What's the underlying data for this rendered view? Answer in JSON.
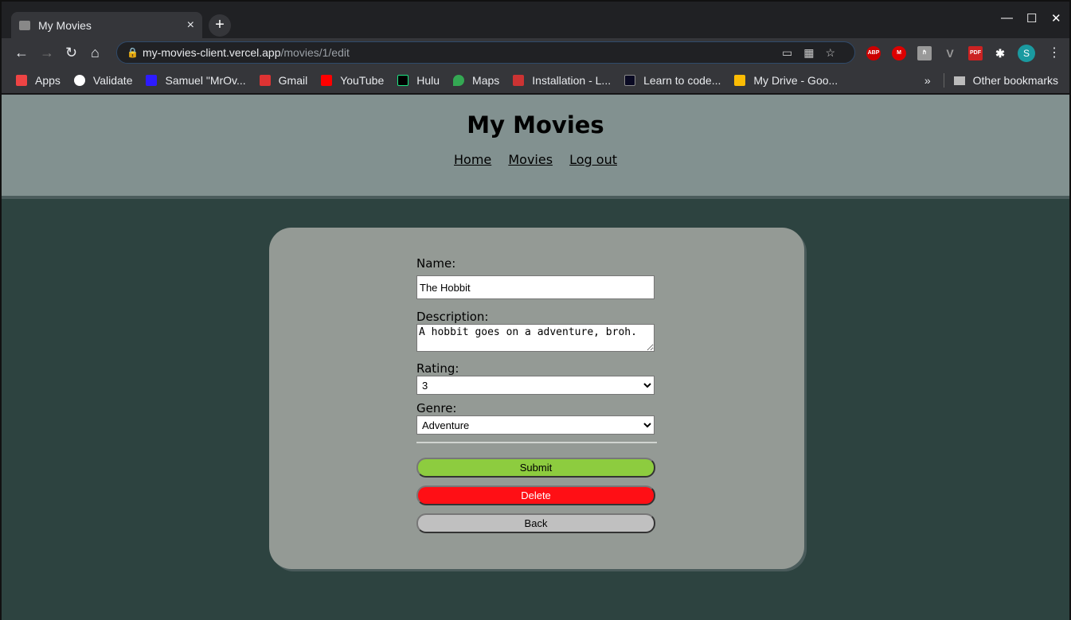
{
  "browser": {
    "tab_title": "My Movies",
    "url_host": "my-movies-client.vercel.app",
    "url_path": "/movies/1/edit",
    "bookmarks": [
      {
        "label": "Apps",
        "color": "#e44"
      },
      {
        "label": "Validate",
        "color": "#fff"
      },
      {
        "label": "Samuel \"MrOv...",
        "color": "#2d1bff"
      },
      {
        "label": "Gmail",
        "color": "#d33"
      },
      {
        "label": "YouTube",
        "color": "#f00"
      },
      {
        "label": "Hulu",
        "color": "#000"
      },
      {
        "label": "Maps",
        "color": "#34a853"
      },
      {
        "label": "Installation - L...",
        "color": "#c33"
      },
      {
        "label": "Learn to code...",
        "color": "#0a0a23"
      },
      {
        "label": "My Drive - Goo...",
        "color": "#fbbc04"
      }
    ],
    "more": "»",
    "other_bookmarks": "Other bookmarks",
    "extensions": [
      {
        "label": "ABP",
        "color": "#c00"
      },
      {
        "label": "M",
        "color": "#d00"
      },
      {
        "label": "ℏ",
        "color": "#999"
      },
      {
        "label": "V",
        "color": "#666"
      },
      {
        "label": "PDF",
        "color": "#c22"
      }
    ],
    "profile": "S"
  },
  "header": {
    "title": "My Movies",
    "nav": [
      "Home",
      "Movies",
      "Log out"
    ]
  },
  "form": {
    "name_label": "Name:",
    "name_value": "The Hobbit",
    "description_label": "Description:",
    "description_value": "A hobbit goes on a adventure, broh.",
    "rating_label": "Rating:",
    "rating_value": "3",
    "genre_label": "Genre:",
    "genre_value": "Adventure",
    "submit": "Submit",
    "delete": "Delete",
    "back": "Back"
  },
  "colors": {
    "submit": "#8dcc3f",
    "delete": "#ff0f15",
    "back": "#c0c0c0"
  }
}
